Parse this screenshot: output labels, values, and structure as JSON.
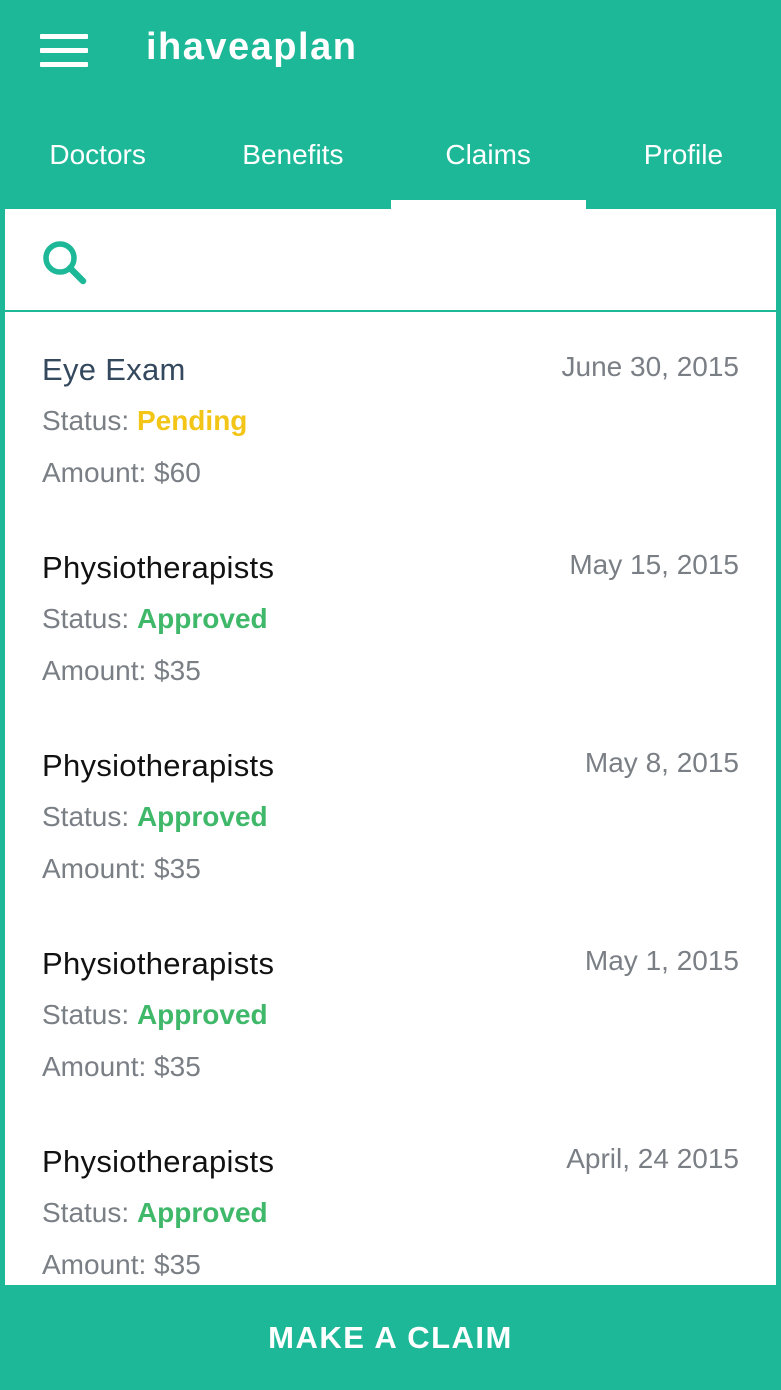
{
  "app": {
    "title": "ihaveaplan",
    "accent": "#1cb897"
  },
  "icons": {
    "menu": "hamburger-menu-icon",
    "search": "search-icon"
  },
  "tabs": [
    {
      "label": "Doctors",
      "active": false
    },
    {
      "label": "Benefits",
      "active": false
    },
    {
      "label": "Claims",
      "active": true
    },
    {
      "label": "Profile",
      "active": false
    }
  ],
  "search": {
    "value": "",
    "placeholder": ""
  },
  "claims": [
    {
      "title": "Eye Exam",
      "date": "June 30, 2015",
      "status_label": "Status:",
      "status": "Pending",
      "status_color": "#f2c516",
      "amount": "Amount: $60"
    },
    {
      "title": "Physiotherapists",
      "date": "May 15, 2015",
      "status_label": "Status:",
      "status": "Approved",
      "status_color": "#3fb86a",
      "amount": "Amount: $35"
    },
    {
      "title": "Physiotherapists",
      "date": "May 8, 2015",
      "status_label": "Status:",
      "status": "Approved",
      "status_color": "#3fb86a",
      "amount": "Amount: $35"
    },
    {
      "title": "Physiotherapists",
      "date": "May 1, 2015",
      "status_label": "Status:",
      "status": "Approved",
      "status_color": "#3fb86a",
      "amount": "Amount: $35"
    },
    {
      "title": "Physiotherapists",
      "date": "April, 24 2015",
      "status_label": "Status:",
      "status": "Approved",
      "status_color": "#3fb86a",
      "amount": "Amount: $35"
    }
  ],
  "cta": {
    "label": "MAKE A CLAIM"
  }
}
